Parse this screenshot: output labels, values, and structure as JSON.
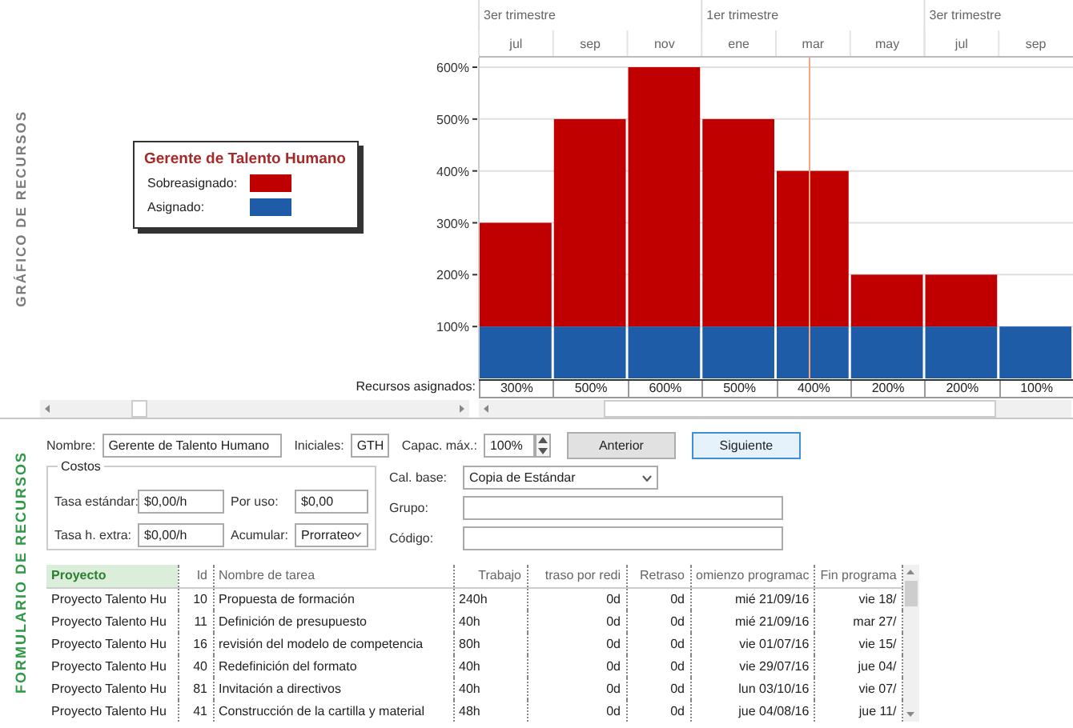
{
  "chart_panel": {
    "title": "GRÁFICO DE RECURSOS",
    "legend": {
      "title": "Gerente de Talento Humano"
    },
    "timescale": {
      "quarters": [
        "3er trimestre",
        "1er trimestre",
        "3er trimestre"
      ]
    },
    "chart_data": {
      "type": "bar",
      "stacked": true,
      "categories": [
        "jul",
        "sep",
        "nov",
        "ene",
        "mar",
        "may",
        "jul",
        "sep"
      ],
      "series": [
        {
          "name": "Asignado:",
          "color": "#1f5ca8",
          "values": [
            100,
            100,
            100,
            100,
            100,
            100,
            100,
            100
          ]
        },
        {
          "name": "Sobreasignado:",
          "color": "#c00000",
          "values": [
            200,
            400,
            500,
            400,
            300,
            100,
            100,
            0
          ]
        }
      ],
      "ylim": [
        0,
        600
      ],
      "grid": true,
      "yticks": [
        {
          "value": 100,
          "label": "100%"
        },
        {
          "value": 200,
          "label": "200%"
        },
        {
          "value": 300,
          "label": "300%"
        },
        {
          "value": 400,
          "label": "400%"
        },
        {
          "value": 500,
          "label": "500%"
        },
        {
          "value": 600,
          "label": "600%"
        }
      ]
    },
    "assigned_row": {
      "label": "Recursos asignados:",
      "values": [
        "300%",
        "500%",
        "600%",
        "500%",
        "400%",
        "200%",
        "200%",
        "100%"
      ]
    }
  },
  "form": {
    "title": "FORMULARIO DE RECURSOS",
    "name": {
      "label": "Nombre:",
      "value": "Gerente de Talento Humano"
    },
    "initials": {
      "label": "Iniciales:",
      "value": "GTH"
    },
    "max_units": {
      "label": "Capac. máx.:",
      "value": "100%"
    },
    "buttons": [
      {
        "label": "Anterior",
        "selected": false
      },
      {
        "label": "Siguiente",
        "selected": true
      }
    ],
    "costs": {
      "title": "Costos",
      "standard_rate": {
        "label": "Tasa estándar:",
        "value": "$0,00/h"
      },
      "per_use": {
        "label": "Por uso:",
        "value": "$0,00"
      },
      "overtime_rate": {
        "label": "Tasa h. extra:",
        "value": "$0,00/h"
      },
      "accrue": {
        "label": "Acumular:",
        "value": "Prorrateo"
      }
    },
    "base_calendar": {
      "label": "Cal. base:",
      "value": "Copia de Estándar"
    },
    "group": {
      "label": "Grupo:"
    },
    "code": {
      "label": "Código:"
    }
  },
  "table": {
    "columns": [
      "Proyecto",
      "Id",
      "Nombre de tarea",
      "Trabajo",
      "traso por redi",
      "Retraso",
      "omienzo programac",
      "Fin programa"
    ],
    "rows": [
      {
        "cells": [
          "Proyecto Talento Hu",
          "10",
          "Propuesta de formación",
          "240h",
          "0d",
          "0d",
          "mié 21/09/16",
          "vie 18/"
        ]
      },
      {
        "cells": [
          "Proyecto Talento Hu",
          "11",
          "Definición de presupuesto",
          "40h",
          "0d",
          "0d",
          "mié 21/09/16",
          "mar 27/"
        ]
      },
      {
        "cells": [
          "Proyecto Talento Hu",
          "16",
          "revisión del modelo de competencia",
          "80h",
          "0d",
          "0d",
          "vie 01/07/16",
          "vie 15/"
        ]
      },
      {
        "cells": [
          "Proyecto Talento Hu",
          "40",
          "Redefinición del formato",
          "40h",
          "0d",
          "0d",
          "vie 29/07/16",
          "jue 04/"
        ]
      },
      {
        "cells": [
          "Proyecto Talento Hu",
          "81",
          "Invitación a directivos",
          "40h",
          "0d",
          "0d",
          "lun 03/10/16",
          "vie 07/"
        ]
      },
      {
        "cells": [
          "Proyecto Talento Hu",
          "41",
          "Construcción de la cartilla y material",
          "48h",
          "0d",
          "0d",
          "jue 04/08/16",
          "jue 11/"
        ]
      }
    ]
  }
}
